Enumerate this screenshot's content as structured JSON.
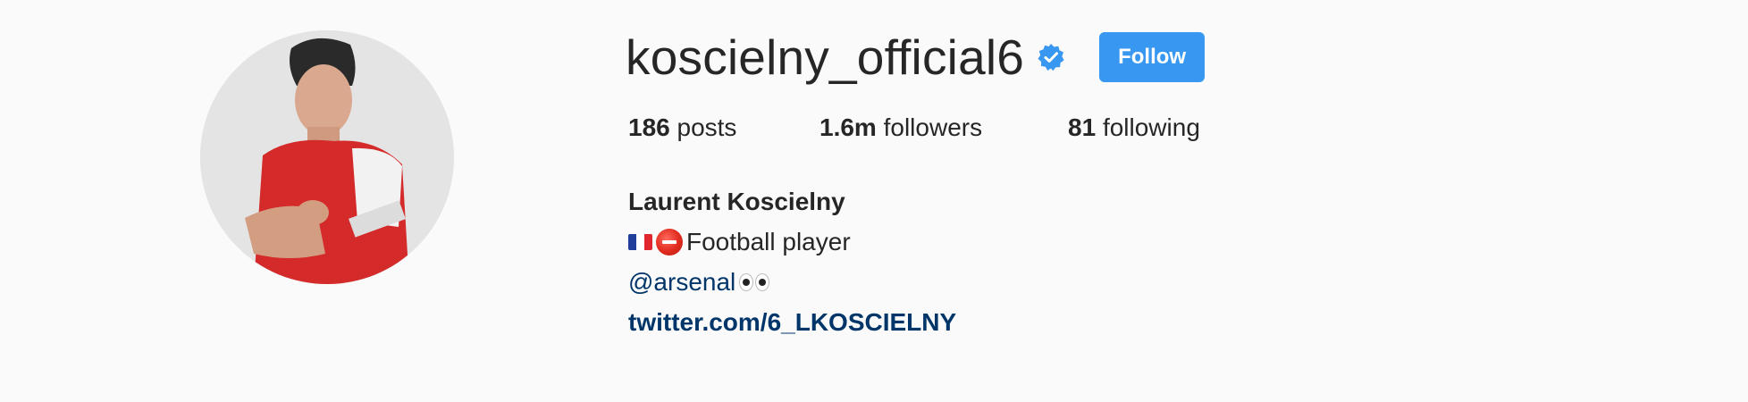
{
  "profile": {
    "username": "koscielny_official6",
    "verified": true,
    "follow_label": "Follow",
    "stats": {
      "posts_count": "186",
      "posts_label": "posts",
      "followers_count": "1.6m",
      "followers_label": "followers",
      "following_count": "81",
      "following_label": "following"
    },
    "full_name": "Laurent Koscielny",
    "bio_text": "Football player",
    "mention": "@arsenal",
    "website": "twitter.com/6_LKOSCIELNY",
    "icons": {
      "verified": "verified-badge-icon",
      "flag": "france-flag-emoji",
      "ball": "red-circle-emoji",
      "eyes": "eyes-emoji"
    }
  },
  "colors": {
    "background": "#fafafa",
    "primary_text": "#262626",
    "follow_button": "#3897f0",
    "link": "#003569",
    "verified_badge": "#3897f0"
  }
}
